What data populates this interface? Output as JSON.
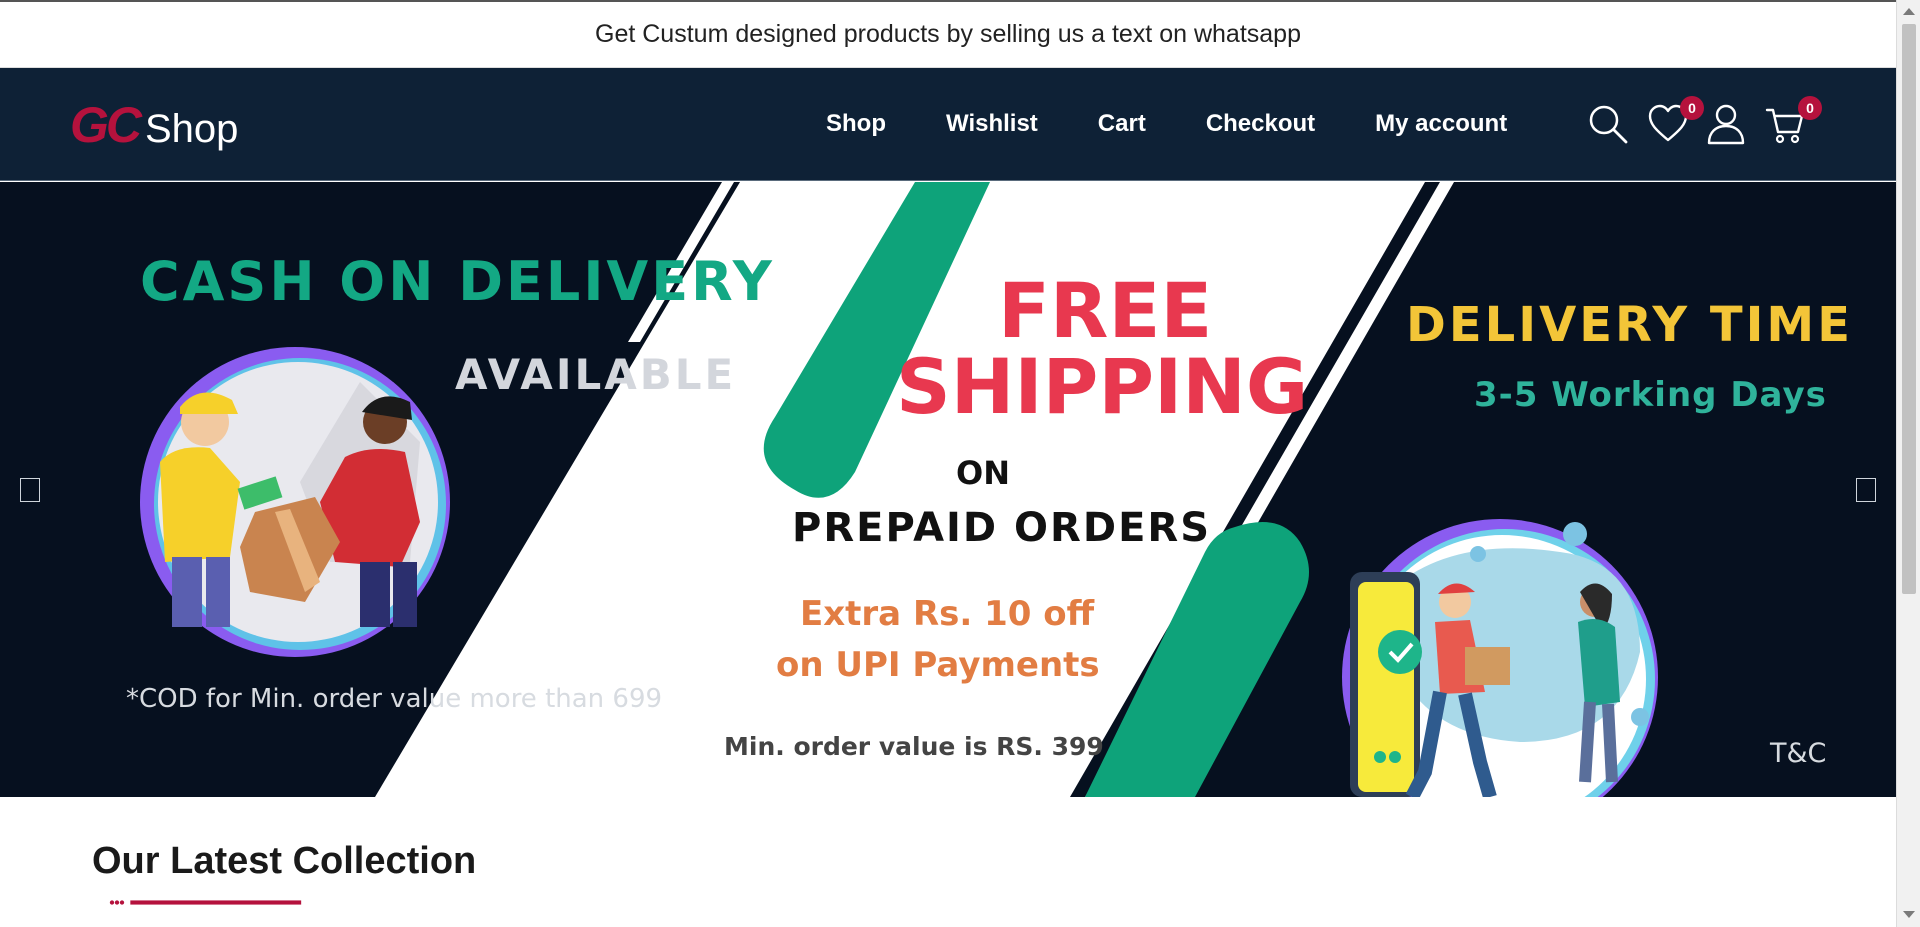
{
  "announcement": "Get Custum designed products by selling us a text on whatsapp",
  "logo": {
    "mark": "GC",
    "text": "Shop"
  },
  "nav": [
    "Shop",
    "Wishlist",
    "Cart",
    "Checkout",
    "My account"
  ],
  "header_icons": {
    "search": "search-icon",
    "wishlist": {
      "icon": "heart-icon",
      "count": "0"
    },
    "account": "user-icon",
    "cart": {
      "icon": "cart-icon",
      "count": "0"
    }
  },
  "banner": {
    "left_title": "CASH ON DELIVERY",
    "left_subtitle": "AVAILABLE",
    "left_note": "*COD for Min. order value more than 699",
    "center_line1": "FREE",
    "center_line2": "SHIPPING",
    "center_on": "ON",
    "center_prepaid": "PREPAID ORDERS",
    "center_extra1": "Extra Rs. 10 off",
    "center_extra2": "on UPI Payments",
    "center_min": "Min. order value is RS. 399",
    "right_title": "DELIVERY TIME",
    "right_subtitle": "3-5 Working Days",
    "tc": "T&C"
  },
  "section_title": "Our Latest Collection",
  "colors": {
    "header_bg": "#0e2136",
    "accent": "#b5123d",
    "banner_bg": "#06101f",
    "green": "#0ea37a",
    "red": "#e8384f",
    "yellow": "#f3c538",
    "orange": "#e27d43"
  }
}
